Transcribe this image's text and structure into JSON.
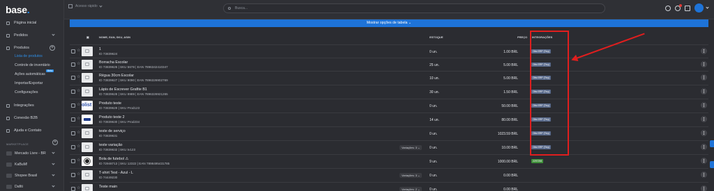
{
  "app": {
    "logo_text": "base",
    "logo_dot": "."
  },
  "topbar": {
    "quick_access": "Acesso rápido",
    "search_placeholder": "Busca..."
  },
  "sidebar": {
    "items": [
      {
        "label": "Página inicial"
      },
      {
        "label": "Pedidos"
      },
      {
        "label": "Produtos"
      }
    ],
    "products_sub": [
      {
        "label": "Lista de produtos",
        "active": true
      },
      {
        "label": "Controle de inventário"
      },
      {
        "label": "Ações automáticas",
        "badge": "Beta"
      },
      {
        "label": "Importar/Exportar"
      },
      {
        "label": "Configurações"
      }
    ],
    "items2": [
      {
        "label": "Integrações"
      },
      {
        "label": "Conexão B2B"
      },
      {
        "label": "Ajuda e Contato"
      }
    ],
    "marketplace_title": "MARKETPLACE",
    "marketplaces": [
      {
        "label": "Mercado Livre - BR"
      },
      {
        "label": "KaBuM!"
      },
      {
        "label": "Shopee Brasil"
      },
      {
        "label": "Dafiti"
      }
    ]
  },
  "table": {
    "show_options": "Mostrar opções de tabela ⌄",
    "headers": {
      "name": "NOME, EAN, SKU, ASIN",
      "stock": "ESTOQUE",
      "price": "PREÇO",
      "integrations": "INTEGRAÇÕES"
    },
    "rows": [
      {
        "name": "1",
        "ids": "ID 73839624",
        "stock": "0 un.",
        "price": "1.00 BRL",
        "integration": "Olist ERP (Tiny)",
        "thumb": "camera"
      },
      {
        "name": "Borracha Escolar",
        "ids": "ID 73839626 | SKU 5678 | EAN 7896342410347",
        "stock": "25 un.",
        "price": "5.00 BRL",
        "integration": "Olist ERP (Tiny)",
        "thumb": "camera"
      },
      {
        "name": "Régua 30cm Escolar",
        "ids": "ID 73839627 | SKU 9090 | EAN 7896326902769",
        "stock": "10 un.",
        "price": "5.00 BRL",
        "integration": "Olist ERP (Tiny)",
        "thumb": "camera"
      },
      {
        "name": "Lápis de Escrever Grafite B1",
        "ids": "ID 73839628 | SKU 8989 | EAN 7896326921265",
        "stock": "30 un.",
        "price": "1.50 BRL",
        "integration": "Olist ERP (Tiny)",
        "thumb": "camera"
      },
      {
        "name": "Produto teste",
        "ids": "ID 73839629 | SKU Prod123",
        "stock": "0 un.",
        "price": "50.00 BRL",
        "integration": "Olist ERP (Tiny)",
        "thumb": "olist"
      },
      {
        "name": "Produto teste 2",
        "ids": "ID 73839630 | SKU Prod234",
        "stock": "14 un.",
        "price": "80.00 BRL",
        "integration": "Olist ERP (Tiny)",
        "thumb": "card"
      },
      {
        "name": "teste de serviço",
        "ids": "ID 73839631",
        "stock": "0 un.",
        "price": "1023.59 BRL",
        "integration": "Olist ERP (Tiny)",
        "thumb": "camera"
      },
      {
        "name": "teste variação",
        "ids": "ID 73839632 | SKU tv123",
        "stock": "0 un.",
        "price": "10.00 BRL",
        "integration": "Olist ERP (Tiny)",
        "thumb": "camera",
        "variation": "Variações: 3 ⌄"
      },
      {
        "name": "Bola de futebol ⚠",
        "ids": "ID 72948713 | SKU 12322 | EAN 7898495431785",
        "stock": "9 un.",
        "price": "1000.00 BRL",
        "integration": "2297298",
        "thumb": "ball",
        "integration_color": "green"
      },
      {
        "name": "T-shirt Test - Azul - L",
        "ids": "ID 74449230",
        "stock": "0 un.",
        "price": "0.00 BRL",
        "integration": "",
        "thumb": "camera",
        "variation": "Variações: 3 ⌄"
      },
      {
        "name": "Teste main",
        "ids": "",
        "stock": "0 un.",
        "price": "0.00 BRL",
        "integration": "",
        "thumb": "camera",
        "variation": "Variações: 2 ⌄"
      }
    ]
  },
  "colors": {
    "accent": "#1e73d8",
    "highlight": "#e01e1e"
  }
}
